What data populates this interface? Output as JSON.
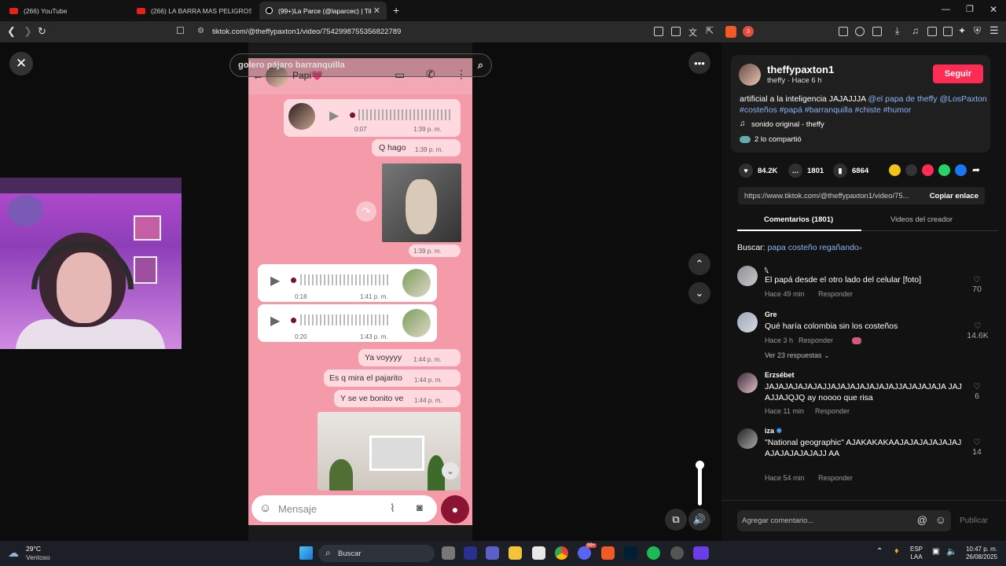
{
  "browser": {
    "tabs": [
      {
        "title": "(266) YouTube",
        "icon": "youtube-icon"
      },
      {
        "title": "(266) LA BARRA MAS PELIGROSA DE",
        "icon": "youtube-icon"
      },
      {
        "title": "(99+)La Parce (@laparcec) | TikTo",
        "icon": "tiktok-icon"
      }
    ],
    "url": "tiktok.com/@theffypaxton1/video/7542998755356822789",
    "extension_badge": "3"
  },
  "video": {
    "search_overlay_text": "golero pájaro barranquilla",
    "chat": {
      "contact_name": "Papi💗",
      "messages": [
        {
          "type": "audio",
          "duration": "0:07",
          "time": "1:39 p. m."
        },
        {
          "type": "text",
          "text": "Q hago",
          "time": "1:39 p. m."
        },
        {
          "type": "image",
          "time": "1:39 p. m."
        },
        {
          "type": "audio-in",
          "duration": "0:18",
          "time": "1:41 p. m."
        },
        {
          "type": "audio-in",
          "duration": "0:20",
          "time": "1:43 p. m."
        },
        {
          "type": "text",
          "text": "Ya voyyyy",
          "time": "1:44 p. m."
        },
        {
          "type": "text",
          "text": "Es q mira el pajarito",
          "time": "1:44 p. m."
        },
        {
          "type": "text",
          "text": "Y se ve bonito ve",
          "time": "1:44 p. m."
        }
      ],
      "input_placeholder": "Mensaje"
    }
  },
  "panel": {
    "username": "theffypaxton1",
    "subline": "theffy · Hace 6 h",
    "follow_label": "Seguir",
    "description_plain": "artificial a la inteligencia JAJAJJJA ",
    "description_tags_1": "@el papa de theffy",
    "description_tags_2": "@LosPaxton #costeños #papá #barranquilla #chiste #humor",
    "sound": "sonido original - theffy",
    "shared": "2 lo compartió",
    "stats": {
      "likes": "84.2K",
      "comments": "1801",
      "saves": "6864"
    },
    "link": "https://www.tiktok.com/@theffypaxton1/video/75...",
    "copy_label": "Copiar enlace",
    "tab_comments": "Comentarios (1801)",
    "tab_creator": "Videos del creador",
    "search_prefix": "Buscar:",
    "search_term": "papa costeño regañando",
    "comments": [
      {
        "user": "𓆩",
        "text": "El papá desde el otro lado del celular [foto]",
        "time": "Hace 49 min",
        "reply": "Responder",
        "likes": "70"
      },
      {
        "user": "Gre",
        "text": "Qué haría colombia sin los costeños",
        "time": "Hace 3 h",
        "reply": "Responder",
        "likes": "14.6K",
        "replies": "Ver 23 respuestas"
      },
      {
        "user": "Erzsébet",
        "text": "JAJAJAJAJAJAJJAJAJAJAJAJAJAJJAJAJAJAJA JAJAJJAJQJQ ay noooo que risa",
        "time": "Hace 11 min",
        "reply": "Responder",
        "likes": "6"
      },
      {
        "user": "iza",
        "text": "\"National geographic\" AJAKAKAKAAJAJAJAJAJAJAJAJAJAJAJAJAJJ AA",
        "time": "Hace 54 min",
        "reply": "Responder",
        "likes": "14"
      }
    ],
    "comment_placeholder": "Agregar comentario...",
    "publish_label": "Publicar"
  },
  "taskbar": {
    "weather_temp": "29°C",
    "weather_desc": "Ventoso",
    "search_label": "Buscar",
    "lang": "ESP",
    "lang_sub": "LAA",
    "time": "10:47 p. m.",
    "date": "26/08/2025",
    "discord_badge": "99+"
  },
  "colors": {
    "follow": "#fe2c55",
    "link": "#8ab4f8",
    "chat_bg": "#f59aa8"
  }
}
